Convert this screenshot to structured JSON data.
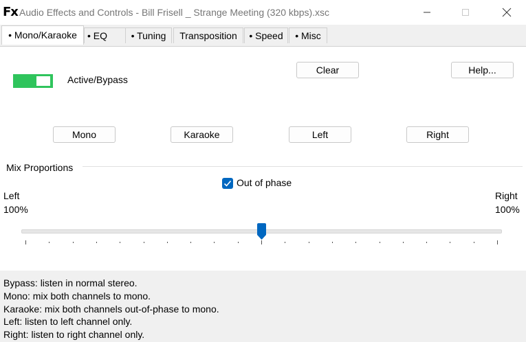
{
  "window": {
    "app_icon": "Fx",
    "title": "Audio Effects and Controls - Bill Frisell _ Strange Meeting (320 kbps).xsc",
    "icons": {
      "minimize": "minimize-icon",
      "maximize": "maximize-icon",
      "close": "close-icon"
    }
  },
  "tabs": [
    {
      "label": "• Mono/Karaoke",
      "active": true
    },
    {
      "label": "• EQ",
      "active": false
    },
    {
      "label": "• Tuning",
      "active": false
    },
    {
      "label": "Transposition",
      "active": false
    },
    {
      "label": "• Speed",
      "active": false
    },
    {
      "label": "• Misc",
      "active": false
    }
  ],
  "panel": {
    "active_toggle": {
      "label": "Active/Bypass",
      "on": true,
      "color": "#2fc45c"
    },
    "clear_label": "Clear",
    "help_label": "Help...",
    "mode_buttons": [
      "Mono",
      "Karaoke",
      "Left",
      "Right"
    ],
    "mix": {
      "group_label": "Mix Proportions",
      "checkbox_label": "Out of phase",
      "checkbox_checked": true,
      "left_label": "Left",
      "left_value": "100%",
      "right_label": "Right",
      "right_value": "100%",
      "slider_position": 0.5,
      "tick_count": 21
    }
  },
  "help_lines": [
    "Bypass: listen in normal stereo.",
    "Mono: mix both channels to mono.",
    "Karaoke: mix both channels out-of-phase to mono.",
    "Left: listen to left channel only.",
    "Right: listen to right channel only."
  ],
  "colors": {
    "accent": "#0067c0",
    "toggle_on": "#2fc45c"
  }
}
